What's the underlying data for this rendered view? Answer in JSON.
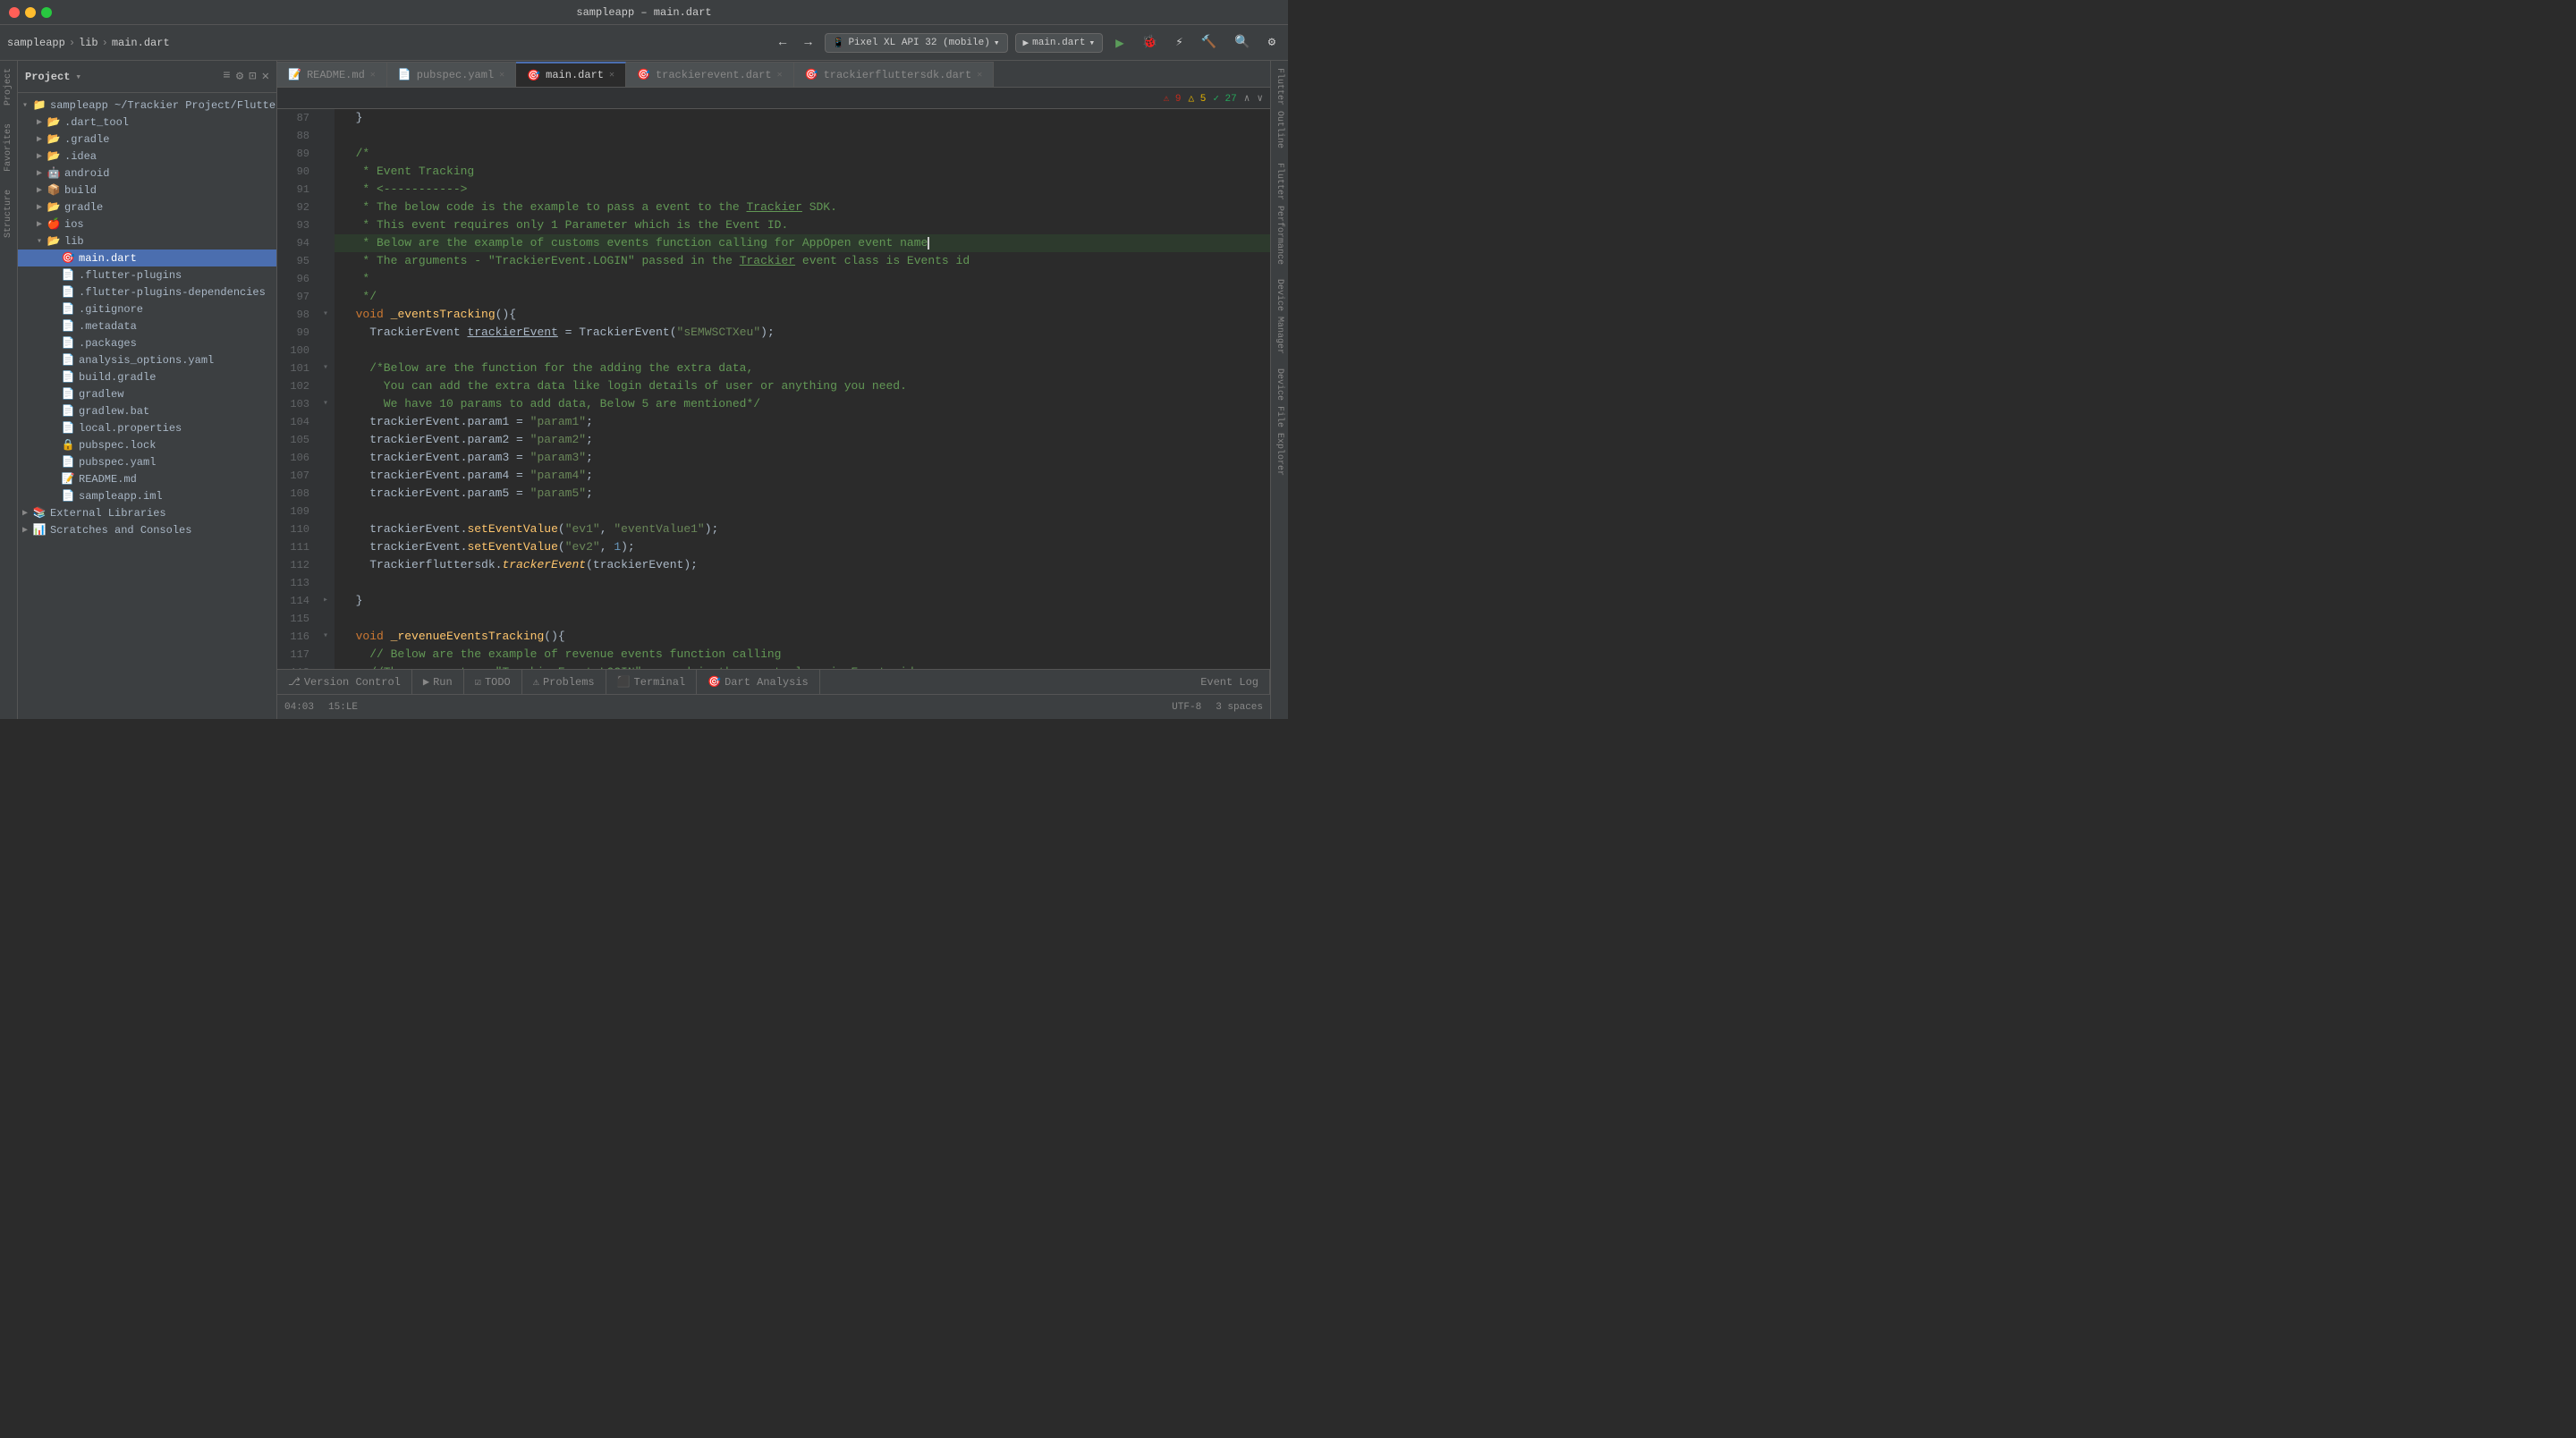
{
  "titleBar": {
    "title": "sampleapp – main.dart",
    "trafficLights": [
      "red",
      "yellow",
      "green"
    ]
  },
  "toolbar": {
    "breadcrumb": [
      "sampleapp",
      "lib",
      "main.dart"
    ],
    "deviceSelector": "Pixel XL API 32 (mobile)",
    "runConfig": "main.dart",
    "backLabel": "←",
    "forwardLabel": "→"
  },
  "projectPanel": {
    "title": "Project",
    "items": [
      {
        "label": "sampleapp ~/Trackier Project/Flutte",
        "level": 0,
        "type": "root",
        "expanded": true
      },
      {
        "label": ".dart_tool",
        "level": 1,
        "type": "folder",
        "expanded": false
      },
      {
        "label": ".gradle",
        "level": 1,
        "type": "folder",
        "expanded": false
      },
      {
        "label": ".idea",
        "level": 1,
        "type": "folder",
        "expanded": false
      },
      {
        "label": "android",
        "level": 1,
        "type": "folder",
        "expanded": false
      },
      {
        "label": "build",
        "level": 1,
        "type": "folder-build",
        "expanded": false
      },
      {
        "label": "gradle",
        "level": 1,
        "type": "folder",
        "expanded": false
      },
      {
        "label": "ios",
        "level": 1,
        "type": "folder",
        "expanded": false
      },
      {
        "label": "lib",
        "level": 1,
        "type": "folder-lib",
        "expanded": true
      },
      {
        "label": "main.dart",
        "level": 2,
        "type": "dart"
      },
      {
        "label": ".flutter-plugins",
        "level": 2,
        "type": "file"
      },
      {
        "label": ".flutter-plugins-dependencies",
        "level": 2,
        "type": "file"
      },
      {
        "label": ".gitignore",
        "level": 2,
        "type": "gitignore"
      },
      {
        "label": ".metadata",
        "level": 2,
        "type": "file"
      },
      {
        "label": ".packages",
        "level": 2,
        "type": "file"
      },
      {
        "label": "analysis_options.yaml",
        "level": 2,
        "type": "yaml"
      },
      {
        "label": "build.gradle",
        "level": 2,
        "type": "gradle"
      },
      {
        "label": "gradlew",
        "level": 2,
        "type": "file"
      },
      {
        "label": "gradlew.bat",
        "level": 2,
        "type": "bat"
      },
      {
        "label": "local.properties",
        "level": 2,
        "type": "properties"
      },
      {
        "label": "pubspec.lock",
        "level": 2,
        "type": "lock"
      },
      {
        "label": "pubspec.yaml",
        "level": 2,
        "type": "yaml"
      },
      {
        "label": "README.md",
        "level": 2,
        "type": "md"
      },
      {
        "label": "sampleapp.iml",
        "level": 2,
        "type": "iml"
      },
      {
        "label": "External Libraries",
        "level": 0,
        "type": "ext-lib",
        "expanded": false
      },
      {
        "label": "Scratches and Consoles",
        "level": 0,
        "type": "scratches",
        "expanded": false
      }
    ]
  },
  "tabs": [
    {
      "label": "README.md",
      "active": false,
      "icon": "md"
    },
    {
      "label": "pubspec.yaml",
      "active": false,
      "icon": "yaml"
    },
    {
      "label": "main.dart",
      "active": true,
      "icon": "dart"
    },
    {
      "label": "trackierevent.dart",
      "active": false,
      "icon": "dart"
    },
    {
      "label": "trackierfluttersdk.dart",
      "active": false,
      "icon": "dart"
    }
  ],
  "editorStatus": {
    "errors": "9",
    "warnings": "5",
    "infos": "27"
  },
  "codeLines": [
    {
      "num": 87,
      "text": "  }",
      "hasFold": false
    },
    {
      "num": 88,
      "text": "",
      "hasFold": false
    },
    {
      "num": 89,
      "text": "  /*",
      "hasFold": false,
      "type": "comment"
    },
    {
      "num": 90,
      "text": "   * Event Tracking",
      "hasFold": false,
      "type": "comment"
    },
    {
      "num": 91,
      "text": "   * <------------>",
      "hasFold": false,
      "type": "comment"
    },
    {
      "num": 92,
      "text": "   * The below code is the example to pass a event to the Trackier SDK.",
      "hasFold": false,
      "type": "comment",
      "underlineWord": "Trackier"
    },
    {
      "num": 93,
      "text": "   * This event requires only 1 Parameter which is the Event ID.",
      "hasFold": false,
      "type": "comment"
    },
    {
      "num": 94,
      "text": "   * Below are the example of customs events function calling for AppOpen event name",
      "hasFold": false,
      "type": "comment",
      "cursor": true
    },
    {
      "num": 95,
      "text": "   * The arguments - \"TrackierEvent.LOGIN\" passed in the Trackier event class is Events id",
      "hasFold": false,
      "type": "comment",
      "underlineWord": "Trackier"
    },
    {
      "num": 96,
      "text": "   *",
      "hasFold": false,
      "type": "comment"
    },
    {
      "num": 97,
      "text": "   */",
      "hasFold": false,
      "type": "comment"
    },
    {
      "num": 98,
      "text": "  void _eventsTracking(){",
      "hasFold": true,
      "type": "code"
    },
    {
      "num": 99,
      "text": "    TrackierEvent trackierEvent = TrackierEvent(\"sEMWSCTXeu\");",
      "hasFold": false,
      "type": "code"
    },
    {
      "num": 100,
      "text": "",
      "hasFold": false
    },
    {
      "num": 101,
      "text": "    /*Below are the function for the adding the extra data,",
      "hasFold": true,
      "type": "comment"
    },
    {
      "num": 102,
      "text": "      You can add the extra data like login details of user or anything you need.",
      "hasFold": false,
      "type": "comment"
    },
    {
      "num": 103,
      "text": "      We have 10 params to add data, Below 5 are mentioned*/",
      "hasFold": true,
      "type": "comment"
    },
    {
      "num": 104,
      "text": "    trackierEvent.param1 = \"param1\";",
      "hasFold": false,
      "type": "code"
    },
    {
      "num": 105,
      "text": "    trackierEvent.param2 = \"param2\";",
      "hasFold": false,
      "type": "code"
    },
    {
      "num": 106,
      "text": "    trackierEvent.param3 = \"param3\";",
      "hasFold": false,
      "type": "code"
    },
    {
      "num": 107,
      "text": "    trackierEvent.param4 = \"param4\";",
      "hasFold": false,
      "type": "code"
    },
    {
      "num": 108,
      "text": "    trackierEvent.param5 = \"param5\";",
      "hasFold": false,
      "type": "code"
    },
    {
      "num": 109,
      "text": "",
      "hasFold": false
    },
    {
      "num": 110,
      "text": "    trackierEvent.setEventValue(\"ev1\", \"eventValue1\");",
      "hasFold": false,
      "type": "code"
    },
    {
      "num": 111,
      "text": "    trackierEvent.setEventValue(\"ev2\", 1);",
      "hasFold": false,
      "type": "code"
    },
    {
      "num": 112,
      "text": "    Trackierfluttersdk.trackerEvent(trackierEvent);",
      "hasFold": false,
      "type": "code",
      "italic": "trackerEvent"
    },
    {
      "num": 113,
      "text": "",
      "hasFold": false
    },
    {
      "num": 114,
      "text": "  }",
      "hasFold": true
    },
    {
      "num": 115,
      "text": "",
      "hasFold": false
    },
    {
      "num": 116,
      "text": "  void _revenueEventsTracking(){",
      "hasFold": true,
      "type": "code"
    },
    {
      "num": 117,
      "text": "    // Below are the example of revenue events function calling",
      "hasFold": false,
      "type": "comment"
    },
    {
      "num": 118,
      "text": "    //The arguments - \"TrackierEvent.LOGIN\" passed in the event class is Events id",
      "hasFold": false,
      "type": "comment"
    }
  ],
  "bottomTabs": [
    {
      "label": "Version Control",
      "icon": "vc"
    },
    {
      "label": "Run",
      "icon": "run"
    },
    {
      "label": "TODO",
      "icon": "todo"
    },
    {
      "label": "Problems",
      "icon": "problems"
    },
    {
      "label": "Terminal",
      "icon": "terminal"
    },
    {
      "label": "Dart Analysis",
      "icon": "dart"
    },
    {
      "label": "Event Log",
      "icon": "log"
    }
  ],
  "statusBar": {
    "line": "15",
    "col": "LE",
    "encoding": "UTF-8",
    "spaces": "3 spaces",
    "time": "04:03"
  },
  "rightTabs": [
    "Flutter Outline",
    "Flutter Performance",
    "Device Manager",
    "Device File Explorer"
  ],
  "leftTabs": [
    "Project",
    "Favorites",
    "Structure"
  ]
}
